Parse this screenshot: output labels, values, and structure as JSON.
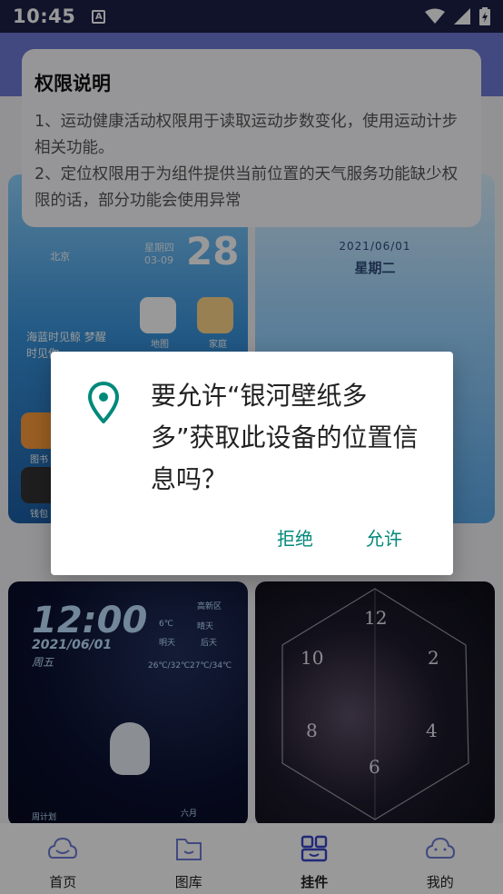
{
  "status_bar": {
    "time": "10:45",
    "a_icon": "A"
  },
  "permission_info": {
    "title": "权限说明",
    "line1": "1、运动健康活动权限用于读取运动步数变化，使用运动计步相关功能。",
    "line2": "2、定位权限用于为组件提供当前位置的天气服务功能缺少权限的话，部分功能会使用异常"
  },
  "cards": {
    "card1": {
      "city": "北京",
      "weekday": "星期四",
      "date_small": "03-09",
      "date_big": "28",
      "quote": "海蓝时见鲸 梦醒时见你",
      "app1": "地图",
      "app2": "家庭",
      "app3": "图书",
      "app4": "钱包"
    },
    "card2": {
      "date": "2021/06/01",
      "weekday": "星期二"
    },
    "card3": {
      "time": "12:00",
      "date": "2021/06/01",
      "weekday": "周五",
      "location": "高新区",
      "weather": "晴天",
      "temp_now": "6℃",
      "tomorrow_label": "明天",
      "after_label": "后天",
      "tomorrow_temp": "26℃/32℃",
      "after_temp": "27℃/34℃",
      "bottom_left": "周计划",
      "bottom_right": "六月"
    },
    "card4": {
      "n12": "12",
      "n2": "2",
      "n4": "4",
      "n6": "6",
      "n8": "8",
      "n10": "10"
    }
  },
  "dialog": {
    "message": "要允许“银河壁纸多多”获取此设备的位置信息吗？",
    "deny": "拒绝",
    "allow": "允许",
    "accent_color": "#00897b"
  },
  "bottom_nav": {
    "items": [
      {
        "label": "首页",
        "icon": "home-icon"
      },
      {
        "label": "图库",
        "icon": "gallery-icon"
      },
      {
        "label": "挂件",
        "icon": "widget-icon"
      },
      {
        "label": "我的",
        "icon": "profile-icon"
      }
    ]
  }
}
